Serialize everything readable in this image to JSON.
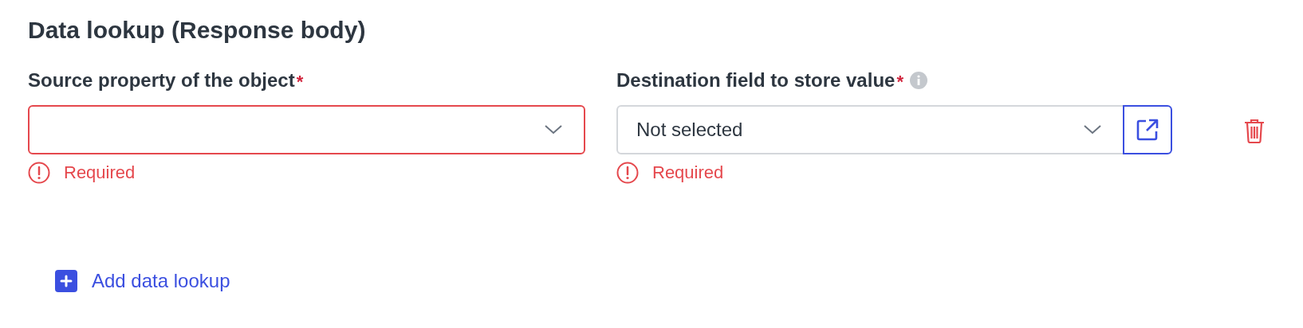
{
  "title": "Data lookup (Response body)",
  "fields": [
    {
      "kind": "select",
      "label": "Source property of the object",
      "required_mark": "*",
      "invalid": true,
      "error": "Required"
    },
    {
      "kind": "select-link",
      "label": "Destination field to store value",
      "required_mark": "*",
      "info": true,
      "invalid": false,
      "value": "Not selected",
      "error": "Required"
    }
  ],
  "add_button": "Add data lookup"
}
